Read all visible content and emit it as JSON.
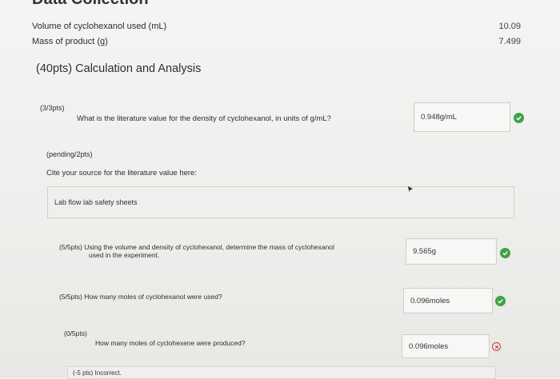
{
  "header": {
    "title_cut": "Data Collection"
  },
  "data_rows": [
    {
      "label": "Volume of cyclohexanol used (mL)",
      "value": "10.09"
    },
    {
      "label": "Mass of product (g)",
      "value": "7.499"
    }
  ],
  "section": {
    "title": "(40pts) Calculation and Analysis"
  },
  "questions": {
    "q1": {
      "points": "(3/3pts)",
      "text": "What is the literature value for the density of cyclohexanol, in units of g/mL?",
      "answer": "0.948g/mL",
      "status": "correct"
    },
    "q2": {
      "points": "(pending/2pts)",
      "text": "Cite your source for the literature value here:",
      "answer": "Lab flow lab safety sheets"
    },
    "q3": {
      "points": "(5/5pts)",
      "text_line1": "Using the volume and density of cyclohexanol, determine the mass of cyclohexanol",
      "text_line2": "used in the experiment.",
      "answer": "9.565g",
      "status": "correct"
    },
    "q4": {
      "points": "(5/5pts)",
      "text": "How many moles of cyclohexanol were used?",
      "answer": "0.096moles",
      "status": "correct"
    },
    "q5": {
      "points": "(0/5pts)",
      "text": "How many moles of cyclohexene were produced?",
      "answer": "0.096moles",
      "status": "incorrect",
      "feedback": "(-5 pts) Incorrect."
    }
  },
  "colors": {
    "correct": "#3ea24a",
    "incorrect": "#cc3b3b"
  },
  "icons": {
    "correct": "check-circle-icon",
    "incorrect": "x-circle-icon"
  }
}
